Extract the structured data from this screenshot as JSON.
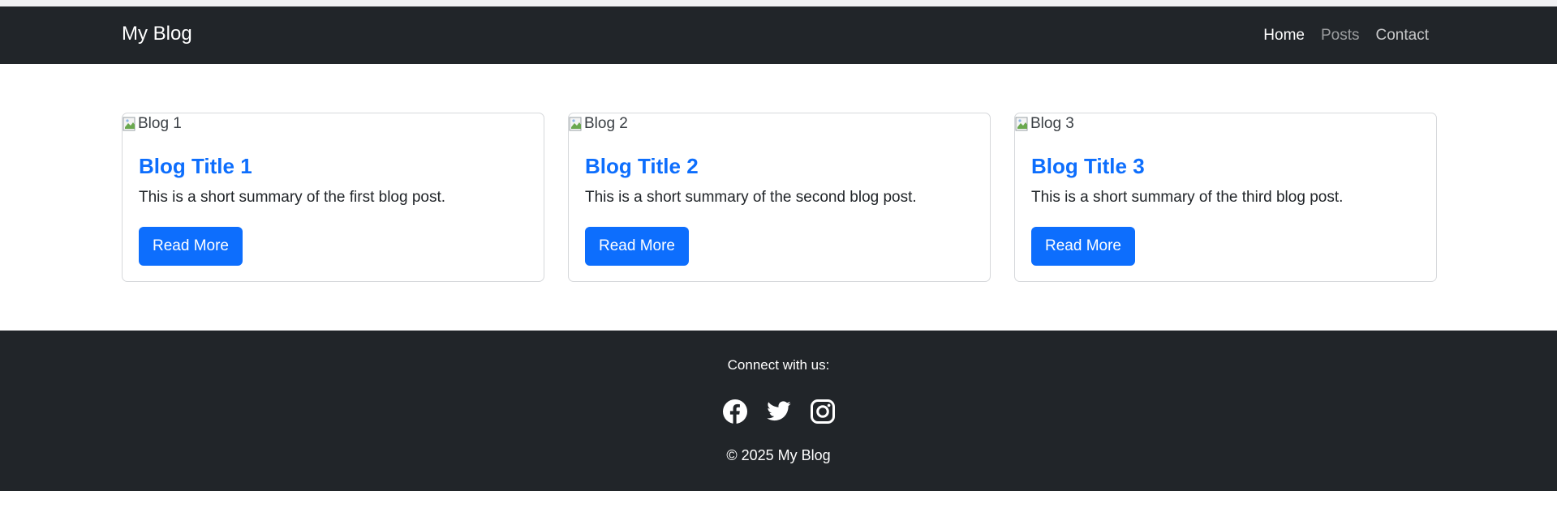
{
  "nav": {
    "brand": "My Blog",
    "links": [
      {
        "label": "Home",
        "state": "active"
      },
      {
        "label": "Posts",
        "state": "muted"
      },
      {
        "label": "Contact",
        "state": "default"
      }
    ]
  },
  "cards": [
    {
      "image_alt": "Blog 1",
      "title": "Blog Title 1",
      "summary": "This is a short summary of the first blog post.",
      "button_label": "Read More"
    },
    {
      "image_alt": "Blog 2",
      "title": "Blog Title 2",
      "summary": "This is a short summary of the second blog post.",
      "button_label": "Read More"
    },
    {
      "image_alt": "Blog 3",
      "title": "Blog Title 3",
      "summary": "This is a short summary of the third blog post.",
      "button_label": "Read More"
    }
  ],
  "footer": {
    "connect_label": "Connect with us:",
    "socials": [
      "facebook-icon",
      "twitter-icon",
      "instagram-icon"
    ],
    "copyright": "© 2025 My Blog"
  },
  "colors": {
    "dark": "#212529",
    "accent": "#0d6efd",
    "text": "#212529"
  }
}
